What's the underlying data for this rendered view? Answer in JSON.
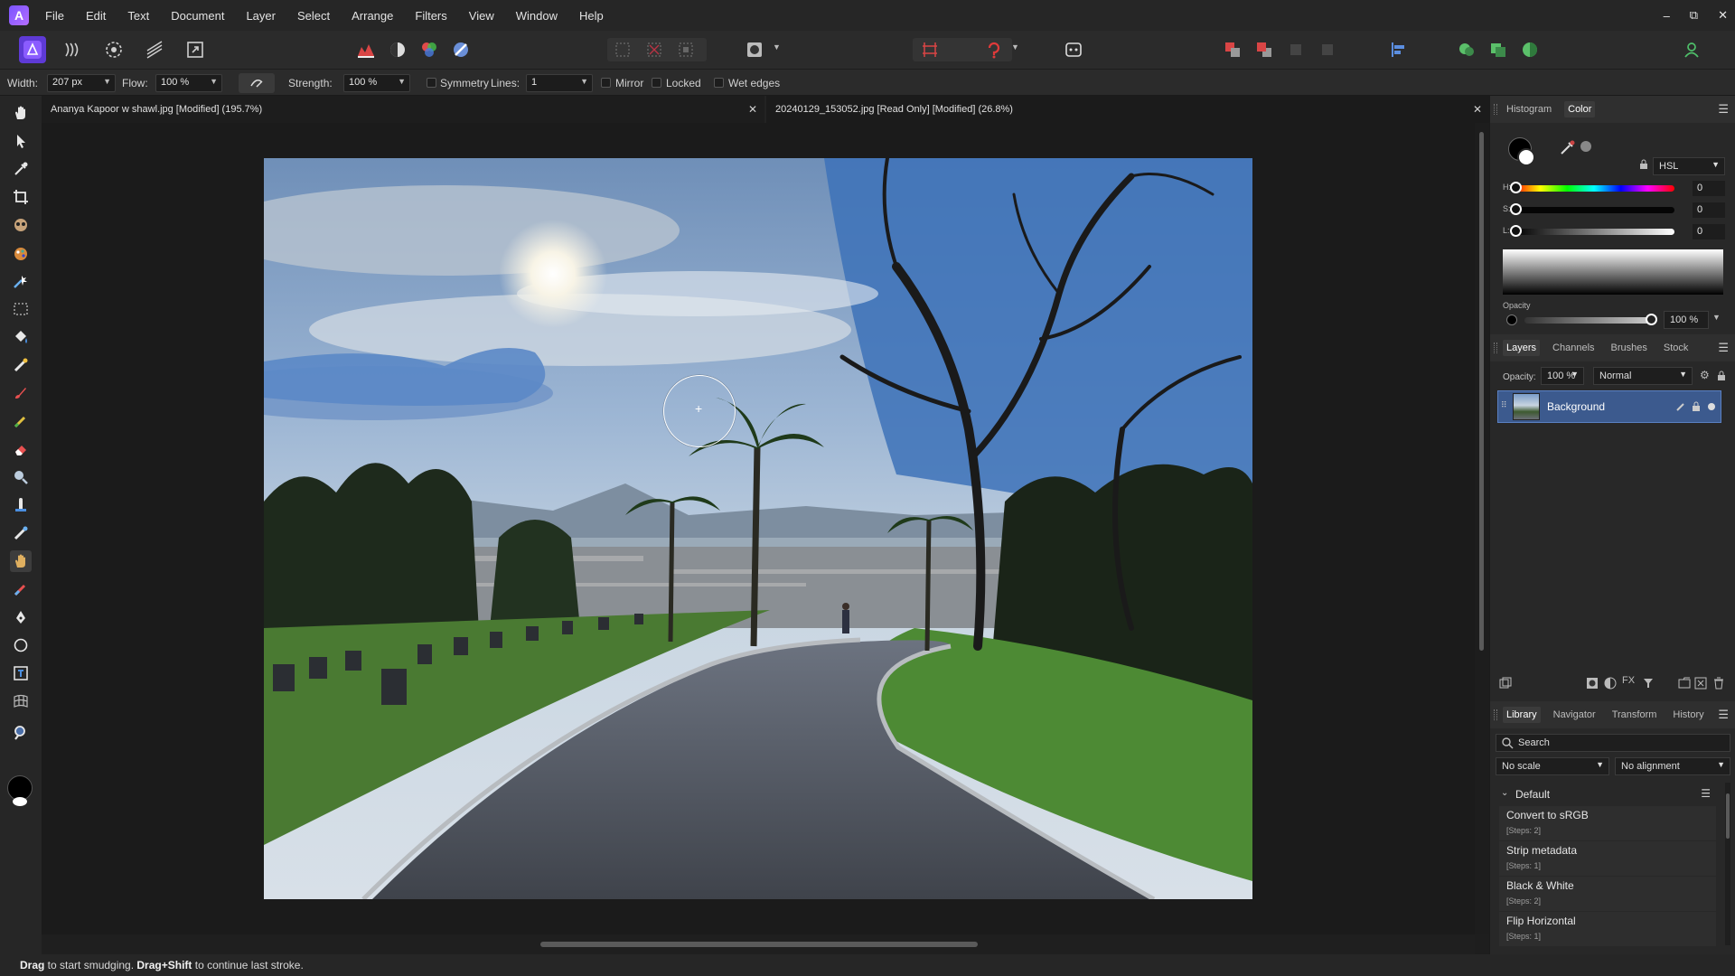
{
  "menubar": {
    "logo": "A",
    "items": [
      "File",
      "Edit",
      "Text",
      "Document",
      "Layer",
      "Select",
      "Arrange",
      "Filters",
      "View",
      "Window",
      "Help"
    ],
    "window_controls": [
      "–",
      "⧉",
      "✕"
    ]
  },
  "context": {
    "width_label": "Width:",
    "width_value": "207 px",
    "flow_label": "Flow:",
    "flow_value": "100 %",
    "strength_label": "Strength:",
    "strength_value": "100 %",
    "symmetry_label": "Symmetry",
    "lines_label": "Lines:",
    "lines_value": "1",
    "mirror_label": "Mirror",
    "locked_label": "Locked",
    "wet_edges_label": "Wet edges"
  },
  "documents": {
    "tabs": [
      {
        "title": "Ananya Kapoor w shawl.jpg [Modified] (195.7%)",
        "close": "✕"
      },
      {
        "title": "20240129_153052.jpg [Read Only] [Modified] (26.8%)",
        "close": "✕"
      }
    ],
    "active_tab": 1
  },
  "status": {
    "part1": "Drag",
    "part2": " to start smudging. ",
    "part3": "Drag+Shift",
    "part4": " to continue last stroke."
  },
  "color_panel": {
    "tabs": [
      "Histogram",
      "Color"
    ],
    "active_tab": "Color",
    "model": "HSL",
    "h_label": "H:",
    "h_value": "0",
    "s_label": "S:",
    "s_value": "0",
    "l_label": "L:",
    "l_value": "0",
    "opacity_label": "Opacity",
    "opacity_value": "100 %"
  },
  "layers_panel": {
    "tabs": [
      "Layers",
      "Channels",
      "Brushes",
      "Stock"
    ],
    "active_tab": "Layers",
    "opacity_label": "Opacity:",
    "opacity_value": "100 %",
    "blend_mode": "Normal",
    "layers": [
      {
        "name": "Background"
      }
    ]
  },
  "library_panel": {
    "tabs": [
      "Library",
      "Navigator",
      "Transform",
      "History"
    ],
    "active_tab": "Library",
    "search_placeholder": "Search",
    "scale": "No scale",
    "alignment": "No alignment",
    "group": "Default",
    "items": [
      {
        "title": "Convert to sRGB",
        "steps": "[Steps: 2]"
      },
      {
        "title": "Strip metadata",
        "steps": "[Steps: 1]"
      },
      {
        "title": "Black & White",
        "steps": "[Steps: 2]"
      },
      {
        "title": "Flip Horizontal",
        "steps": "[Steps: 1]"
      }
    ]
  },
  "colors": {
    "accent": "#3c5a8e",
    "primary_color": "#000000",
    "secondary_color": "#ffffff"
  }
}
